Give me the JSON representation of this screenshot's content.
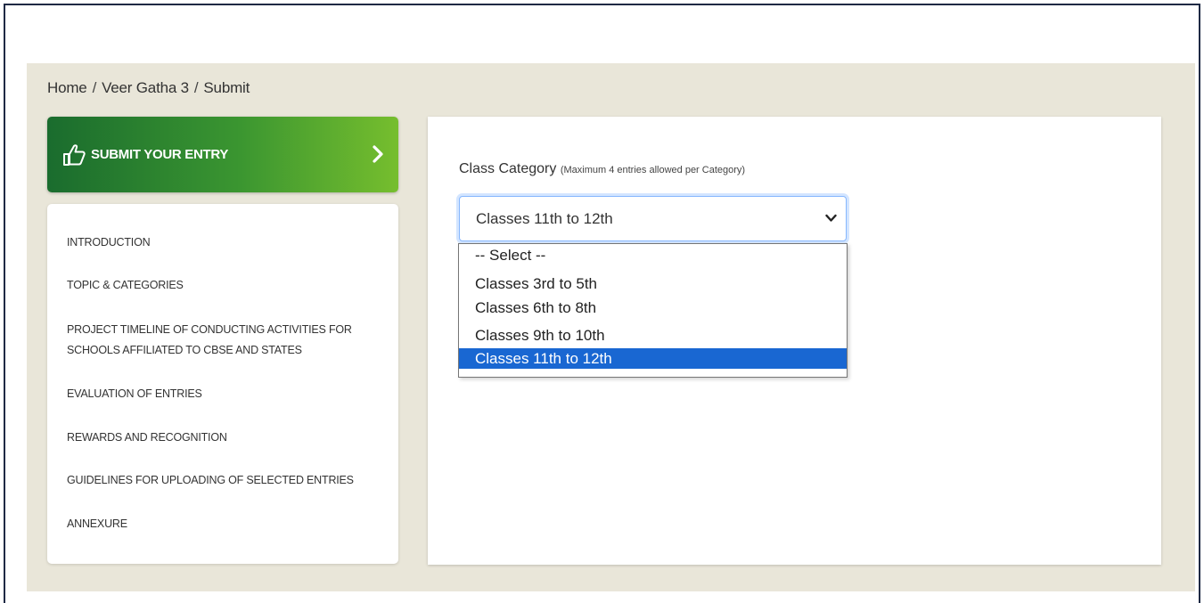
{
  "breadcrumb": [
    "Home",
    "Veer Gatha 3",
    "Submit"
  ],
  "breadcrumb_separator": "/",
  "submit_card": {
    "label": "SUBMIT YOUR ENTRY",
    "icon": "thumbs-up-hand-icon"
  },
  "menu": {
    "items": [
      "INTRODUCTION",
      "TOPIC & CATEGORIES",
      "PROJECT TIMELINE OF CONDUCTING ACTIVITIES FOR SCHOOLS AFFILIATED TO CBSE AND STATES",
      "EVALUATION OF ENTRIES",
      "REWARDS AND RECOGNITION",
      "GUIDELINES FOR UPLOADING OF SELECTED ENTRIES",
      "ANNEXURE"
    ],
    "project_timeline_line1": "PROJECT TIMELINE OF CONDUCTING ACTIVITIES FOR",
    "project_timeline_line2": "SCHOOLS AFFILIATED TO CBSE AND STATES"
  },
  "form": {
    "field_label": "Class Category",
    "field_hint": "(Maximum 4 entries allowed per Category)",
    "selected_value": "Classes 11th to 12th",
    "options": [
      "-- Select --",
      "Classes 3rd to 5th",
      "Classes 6th to 8th",
      "Classes 9th to 10th",
      "Classes 11th to 12th"
    ],
    "highlighted_option": "Classes 11th to 12th"
  },
  "colors": {
    "canvas_bg": "#e9e6d9",
    "submit_gradient_start": "#1a6c2e",
    "submit_gradient_end": "#76be2e",
    "option_highlight": "#1967d2",
    "focus_ring": "#86b7fe"
  }
}
